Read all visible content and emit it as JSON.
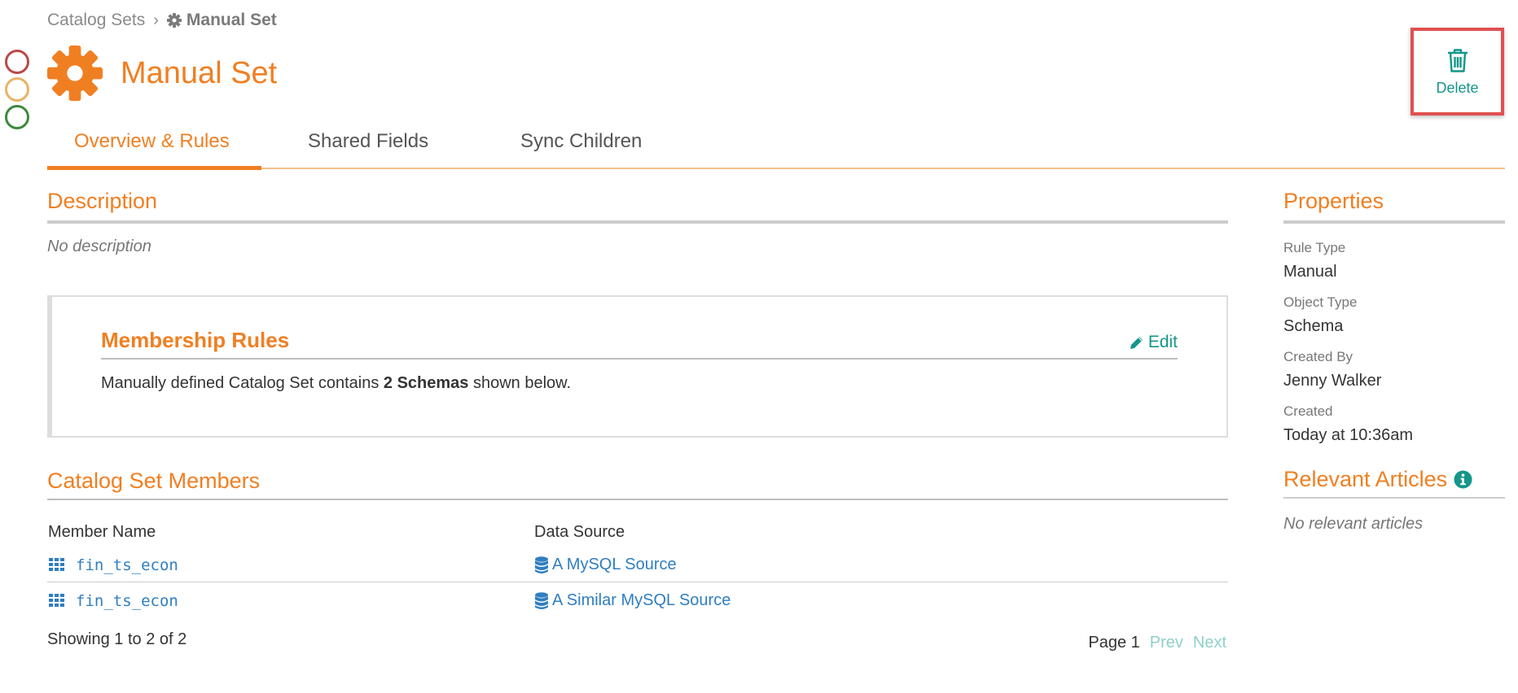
{
  "breadcrumb": {
    "parent": "Catalog Sets",
    "separator": "›",
    "current": "Manual Set"
  },
  "header": {
    "title": "Manual Set",
    "delete_label": "Delete"
  },
  "tabs": [
    {
      "label": "Overview & Rules",
      "active": true
    },
    {
      "label": "Shared Fields",
      "active": false
    },
    {
      "label": "Sync Children",
      "active": false
    }
  ],
  "description": {
    "heading": "Description",
    "text": "No description"
  },
  "membership_rules": {
    "heading": "Membership Rules",
    "edit_label": "Edit",
    "text_before": "Manually defined Catalog Set contains ",
    "text_bold": "2 Schemas",
    "text_after": " shown below."
  },
  "members": {
    "heading": "Catalog Set Members",
    "columns": [
      "Member Name",
      "Data Source"
    ],
    "rows": [
      {
        "name": "fin_ts_econ",
        "source": "A MySQL Source"
      },
      {
        "name": "fin_ts_econ",
        "source": "A Similar MySQL Source"
      }
    ],
    "showing": "Showing 1 to 2 of 2",
    "page_label": "Page 1",
    "prev_label": "Prev",
    "next_label": "Next"
  },
  "properties": {
    "heading": "Properties",
    "items": [
      {
        "label": "Rule Type",
        "value": "Manual"
      },
      {
        "label": "Object Type",
        "value": "Schema"
      },
      {
        "label": "Created By",
        "value": "Jenny Walker"
      },
      {
        "label": "Created",
        "value": "Today at 10:36am"
      }
    ]
  },
  "relevant_articles": {
    "heading": "Relevant Articles",
    "empty_text": "No relevant articles"
  },
  "colors": {
    "accent": "#f07f22",
    "teal": "#14968a",
    "link": "#2f7ec1",
    "highlight_border": "#e05050"
  },
  "icons": {
    "status": [
      "red-circle-icon",
      "amber-circle-icon",
      "green-circle-icon"
    ],
    "title": "gear-icon",
    "delete": "trash-icon",
    "edit": "pencil-icon",
    "member": "table-grid-icon",
    "source": "database-icon",
    "info": "info-circle-icon"
  }
}
